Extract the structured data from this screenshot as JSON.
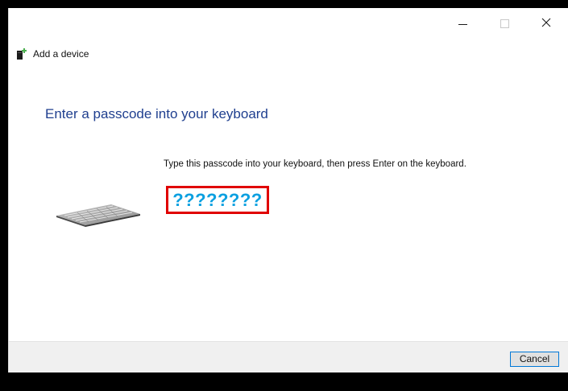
{
  "window": {
    "app_title": "Add a device",
    "controls": {
      "minimize_icon": "minimize-icon",
      "maximize_icon": "maximize-icon",
      "close_icon": "close-icon"
    }
  },
  "content": {
    "heading": "Enter a passcode into your keyboard",
    "instruction": "Type this passcode into your keyboard, then press Enter on the keyboard.",
    "passcode": "????????",
    "image": "keyboard-icon"
  },
  "footer": {
    "cancel_label": "Cancel"
  },
  "colors": {
    "heading": "#1f3f8f",
    "passcode": "#0ba0e0",
    "highlight_border": "#e00000",
    "button_focus": "#0078d7",
    "footer_bg": "#f0f0f0",
    "app_icon_accent": "#4caf50"
  }
}
